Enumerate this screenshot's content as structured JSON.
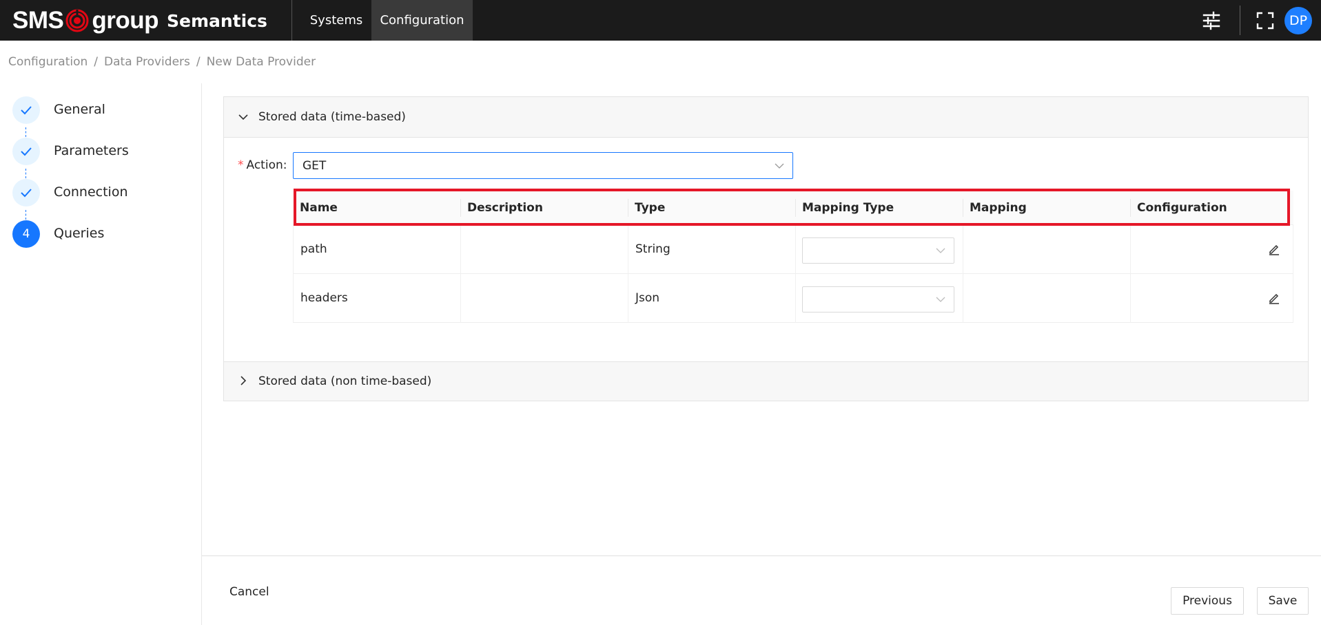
{
  "brand": {
    "part1": "SMS",
    "part2": "group",
    "product": "Semantics"
  },
  "nav": {
    "systems": "Systems",
    "configuration": "Configuration"
  },
  "user": {
    "initials": "DP"
  },
  "breadcrumb": [
    "Configuration",
    "Data Providers",
    "New Data Provider"
  ],
  "breadcrumb_separator": "/",
  "steps": [
    {
      "label": "General",
      "state": "done"
    },
    {
      "label": "Parameters",
      "state": "done"
    },
    {
      "label": "Connection",
      "state": "done"
    },
    {
      "label": "Queries",
      "state": "active",
      "number": "4"
    }
  ],
  "panels": {
    "time_based": {
      "title": "Stored data (time-based)",
      "expanded": true
    },
    "non_time_based": {
      "title": "Stored data (non time-based)",
      "expanded": false
    }
  },
  "action": {
    "label": "Action",
    "required_mark": "*",
    "colon": ":",
    "value": "GET"
  },
  "table": {
    "columns": [
      "Name",
      "Description",
      "Type",
      "Mapping Type",
      "Mapping",
      "Configuration"
    ],
    "rows": [
      {
        "name": "path",
        "description": "",
        "type": "String",
        "mapping_type": "",
        "mapping": ""
      },
      {
        "name": "headers",
        "description": "",
        "type": "Json",
        "mapping_type": "",
        "mapping": ""
      }
    ]
  },
  "footer": {
    "cancel": "Cancel",
    "previous": "Previous",
    "save": "Save"
  },
  "colors": {
    "accent": "#1677ff",
    "highlight": "#e51728",
    "topbar": "#1b1b1b",
    "logo_red": "#e30613"
  }
}
